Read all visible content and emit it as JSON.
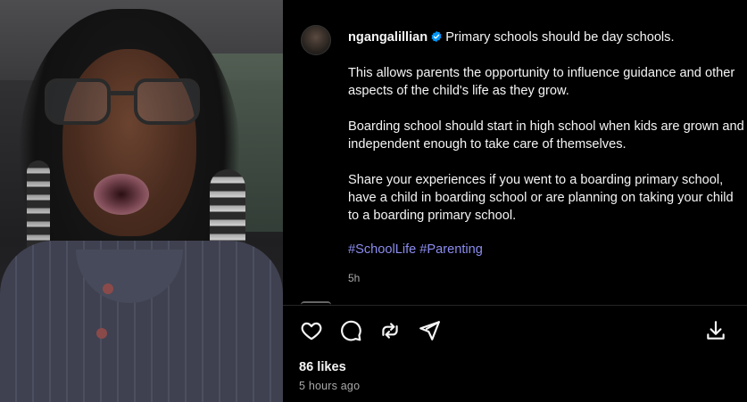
{
  "post": {
    "username": "ngangalillian",
    "verified": true,
    "caption_title": "Primary schools should be day schools.",
    "paragraphs": [
      "This allows parents the opportunity to influence guidance and other aspects of the child's life as they grow.",
      "Boarding school should start in high school when kids are grown and independent enough to take care of themselves.",
      "Share your experiences if you went to a boarding primary school, have a child in boarding school or are planning on taking your child to a boarding primary school."
    ],
    "hashtags": [
      "#SchoolLife",
      "#Parenting"
    ],
    "caption_age": "5h",
    "likes": "86 likes",
    "posted_time": "5 hours ago"
  },
  "actions": {
    "like": "heart-icon",
    "comment": "comment-icon",
    "share": "repost-icon",
    "send": "send-icon",
    "save": "download-icon"
  },
  "colors": {
    "background": "#000000",
    "text": "#f5f5f5",
    "muted": "#a8a8a8",
    "hashtag": "#8c8cf0",
    "verified": "#0095f6"
  }
}
